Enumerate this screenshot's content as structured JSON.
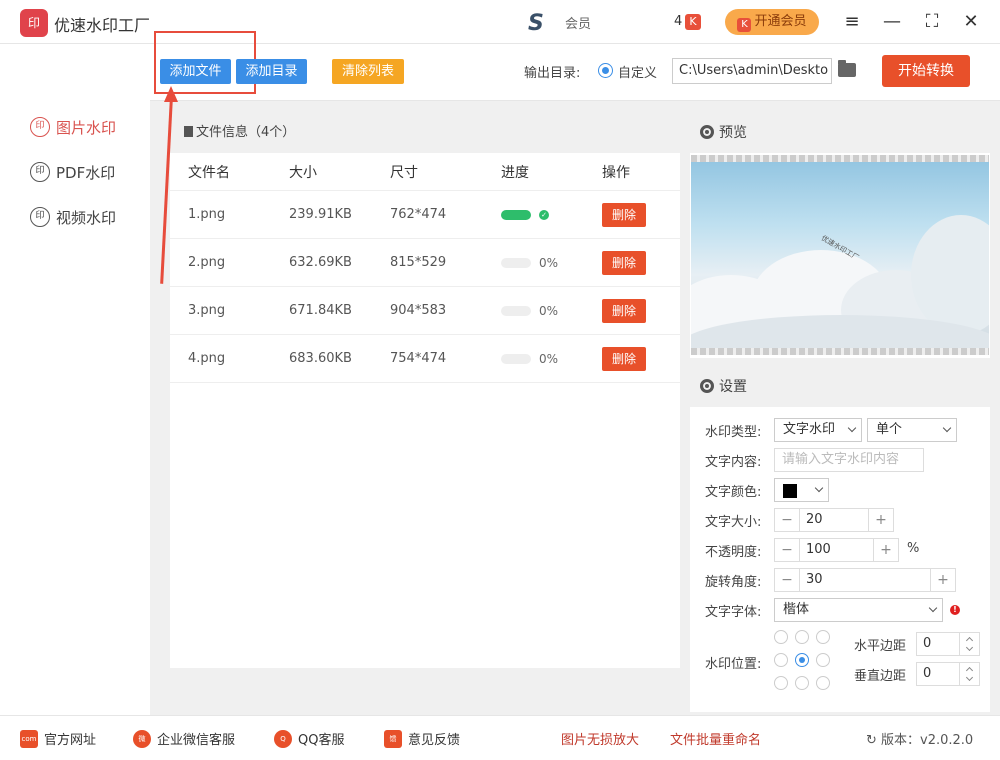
{
  "app": {
    "title": "优速水印工厂",
    "logo_text": "印",
    "svip_mark": "S",
    "member_text": "会员",
    "count": "4",
    "count_badge": "K",
    "vip_button": "开通会员",
    "vip_icon": "K"
  },
  "window": {
    "menu": "≡",
    "minimize": "—",
    "maximize": "⛶",
    "close": "✕"
  },
  "sidebar": {
    "items": [
      {
        "label": "图片水印",
        "icon": "印"
      },
      {
        "label": "PDF水印",
        "icon": "印"
      },
      {
        "label": "视频水印",
        "icon": "印"
      }
    ]
  },
  "toolbar": {
    "add_file": "添加文件",
    "add_dir": "添加目录",
    "clear_list": "清除列表",
    "output_label": "输出目录:",
    "custom_label": "自定义",
    "output_path": "C:\\Users\\admin\\Deskto",
    "start_button": "开始转换"
  },
  "files": {
    "header": "文件信息（4个）",
    "columns": [
      "文件名",
      "大小",
      "尺寸",
      "进度",
      "操作"
    ],
    "rows": [
      {
        "name": "1.png",
        "size": "239.91KB",
        "dims": "762*474",
        "progress": "100%",
        "action": "删除"
      },
      {
        "name": "2.png",
        "size": "632.69KB",
        "dims": "815*529",
        "progress": "0%",
        "action": "删除"
      },
      {
        "name": "3.png",
        "size": "671.84KB",
        "dims": "904*583",
        "progress": "0%",
        "action": "删除"
      },
      {
        "name": "4.png",
        "size": "683.60KB",
        "dims": "754*474",
        "progress": "0%",
        "action": "删除"
      }
    ]
  },
  "preview": {
    "title": "预览",
    "watermark_text": "优速水印工厂"
  },
  "settings": {
    "title": "设置",
    "type_label": "水印类型:",
    "type_value": "文字水印",
    "mode_value": "单个",
    "content_label": "文字内容:",
    "content_placeholder": "请输入文字水印内容",
    "color_label": "文字颜色:",
    "color_value": "#000000",
    "size_label": "文字大小:",
    "size_value": "20",
    "opacity_label": "不透明度:",
    "opacity_value": "100",
    "opacity_unit": "%",
    "rotate_label": "旋转角度:",
    "rotate_value": "30",
    "font_label": "文字字体:",
    "font_value": "楷体",
    "font_warn": "!",
    "position_label": "水印位置:",
    "position_selected": "middle-center",
    "hmargin_label": "水平边距",
    "hmargin_value": "0",
    "vmargin_label": "垂直边距",
    "vmargin_value": "0",
    "minus": "−",
    "plus": "+"
  },
  "footer": {
    "website": "官方网址",
    "website_icon": "com",
    "wechat": "企业微信客服",
    "wechat_icon": "微",
    "qq": "QQ客服",
    "qq_icon": "Q",
    "feedback": "意见反馈",
    "feedback_icon": "馈",
    "enlarge": "图片无损放大",
    "rename": "文件批量重命名",
    "version": "版本：v2.0.2.0"
  }
}
